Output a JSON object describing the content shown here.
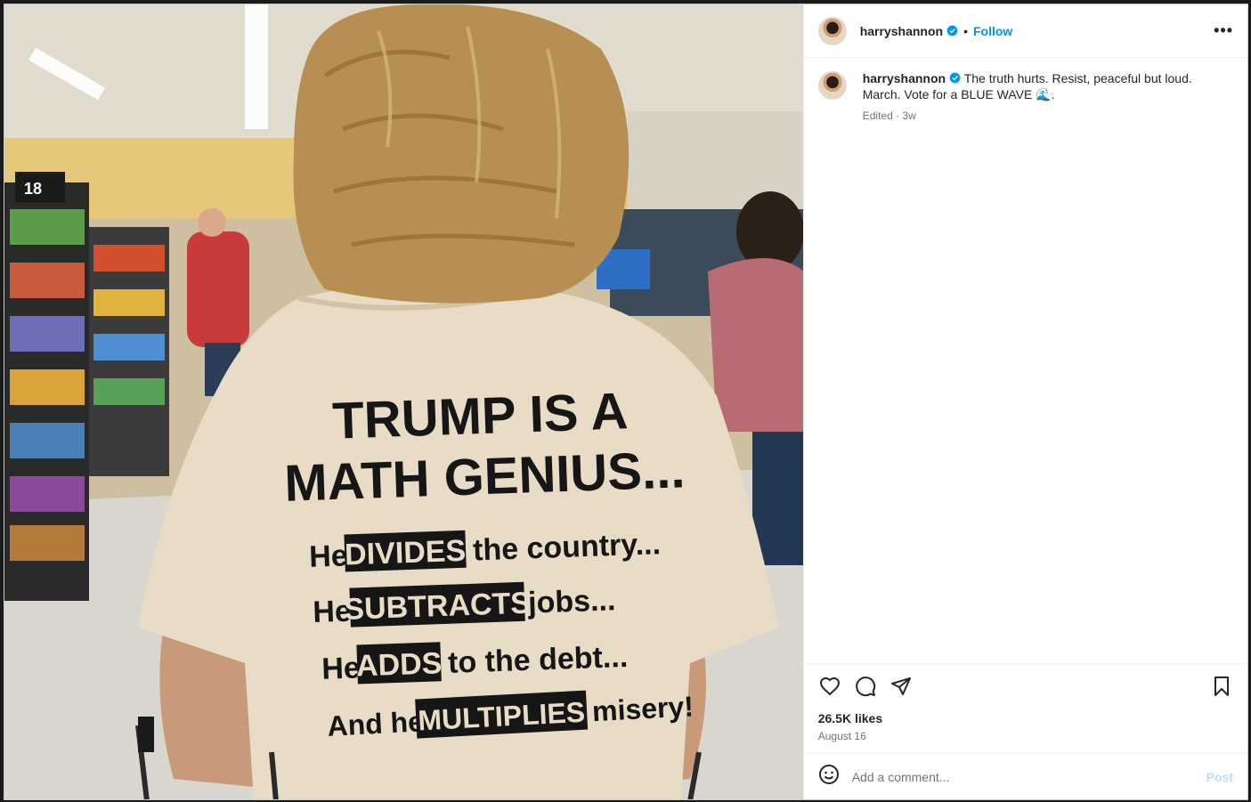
{
  "post": {
    "username": "harryshannon",
    "follow_label": "Follow",
    "separator": "•",
    "more_label": "•••",
    "caption_text": "The truth hurts. Resist, peaceful but loud. March. Vote for a BLUE WAVE 🌊.",
    "edited_label": "Edited · 3w",
    "likes": "26.5K likes",
    "date": "August 16",
    "comment_placeholder": "Add a comment...",
    "post_label": "Post"
  },
  "shirt": {
    "line1": "TRUMP IS A",
    "line2": "MATH GENIUS...",
    "line3_pre": "He",
    "line3_box": "DIVIDES",
    "line3_post": "the country...",
    "line4_pre": "He",
    "line4_box": "SUBTRACTS",
    "line4_post": "jobs...",
    "line5_pre": "He",
    "line5_box": "ADDS",
    "line5_post": "to the debt...",
    "line6_pre": "And he",
    "line6_box": "MULTIPLIES",
    "line6_post": "misery!",
    "aisle_sign": "18"
  },
  "icons": {
    "verified": "verified-badge-icon",
    "like": "heart-icon",
    "comment": "comment-icon",
    "share": "share-icon",
    "save": "bookmark-icon",
    "emoji": "emoji-icon",
    "more": "more-options-icon"
  },
  "colors": {
    "link": "#0095f6",
    "post_disabled": "#b2dffc",
    "shirt": "#e8dcc6",
    "text": "#262626",
    "muted": "#737373"
  }
}
